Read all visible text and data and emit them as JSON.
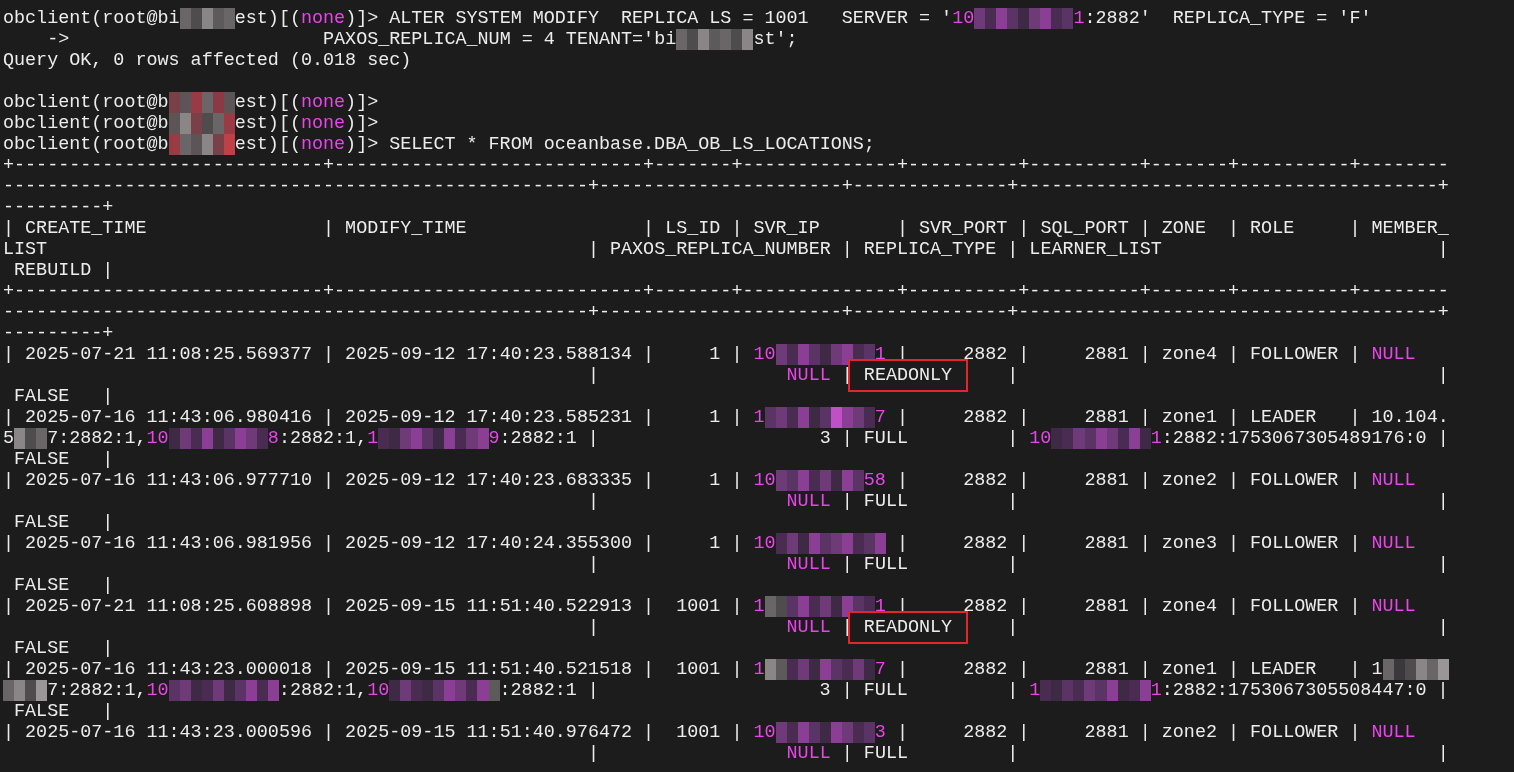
{
  "terminal": {
    "lines": [
      {
        "kind": "text",
        "segments": [
          {
            "kind": "plain",
            "text": "obclient(root@bi"
          },
          {
            "kind": "redacted",
            "tiles": [
              {
                "color": "#6a6668"
              },
              {
                "color": "#4e4c4d"
              },
              {
                "color": "#8a8688"
              },
              {
                "color": "#5c5a5b"
              },
              {
                "color": "#6a6668"
              }
            ]
          },
          {
            "kind": "plain",
            "text": "est)[("
          },
          {
            "kind": "highlight",
            "text": "none"
          },
          {
            "kind": "plain",
            "text": ")]> ALTER SYSTEM MODIFY  REPLICA LS = 1001   SERVER = '"
          },
          {
            "kind": "highlight",
            "text": "10"
          },
          {
            "kind": "redacted",
            "tiles": [
              {
                "color": "#6e3a78"
              },
              {
                "color": "#4a2c52"
              },
              {
                "color": "#8a3f94"
              },
              {
                "color": "#5b3466"
              },
              {
                "color": "#3e2a44"
              },
              {
                "color": "#6e3a78"
              },
              {
                "color": "#8a3f94"
              },
              {
                "color": "#4a2c52"
              },
              {
                "color": "#5b3466"
              }
            ]
          },
          {
            "kind": "highlight",
            "text": "1"
          },
          {
            "kind": "plain",
            "text": ":2882'  REPLICA_TYPE = 'F'"
          }
        ]
      },
      {
        "kind": "text",
        "segments": [
          {
            "kind": "plain",
            "text": "    ->                       PAXOS_REPLICA_NUM = 4 TENANT='bi"
          },
          {
            "kind": "redacted",
            "tiles": [
              {
                "color": "#6a6668"
              },
              {
                "color": "#4e4c4d"
              },
              {
                "color": "#8a8688"
              },
              {
                "color": "#5c5a5b"
              },
              {
                "color": "#6a6668"
              },
              {
                "color": "#4e4c4d"
              },
              {
                "color": "#8a8688"
              }
            ]
          },
          {
            "kind": "plain",
            "text": "st';"
          }
        ]
      },
      {
        "kind": "text",
        "segments": [
          {
            "kind": "plain",
            "text": "Query OK, 0 rows affected (0.018 sec)"
          }
        ]
      },
      {
        "kind": "blank"
      },
      {
        "kind": "text",
        "segments": [
          {
            "kind": "plain",
            "text": "obclient(root@b"
          },
          {
            "kind": "redacted",
            "tiles": [
              {
                "color": "#7a4048"
              },
              {
                "color": "#5c5456"
              },
              {
                "color": "#9a3a44"
              },
              {
                "color": "#6a6668"
              },
              {
                "color": "#8a3a44"
              },
              {
                "color": "#5c5456"
              }
            ]
          },
          {
            "kind": "plain",
            "text": "est)[("
          },
          {
            "kind": "highlight",
            "text": "none"
          },
          {
            "kind": "plain",
            "text": ")]>"
          }
        ]
      },
      {
        "kind": "text",
        "segments": [
          {
            "kind": "plain",
            "text": "obclient(root@b"
          },
          {
            "kind": "redacted",
            "tiles": [
              {
                "color": "#5c5456"
              },
              {
                "color": "#8a8688"
              },
              {
                "color": "#7a4048"
              },
              {
                "color": "#4e4c4d"
              },
              {
                "color": "#6a6668"
              },
              {
                "color": "#9a3a44"
              }
            ]
          },
          {
            "kind": "plain",
            "text": "est)[("
          },
          {
            "kind": "highlight",
            "text": "none"
          },
          {
            "kind": "plain",
            "text": ")]>"
          }
        ]
      },
      {
        "kind": "text",
        "segments": [
          {
            "kind": "plain",
            "text": "obclient(root@b"
          },
          {
            "kind": "redacted",
            "tiles": [
              {
                "color": "#9a3a44"
              },
              {
                "color": "#6a6668"
              },
              {
                "color": "#5c5456"
              },
              {
                "color": "#8a8688"
              },
              {
                "color": "#7a4048"
              },
              {
                "color": "#c04048"
              }
            ]
          },
          {
            "kind": "plain",
            "text": "est)[("
          },
          {
            "kind": "highlight",
            "text": "none"
          },
          {
            "kind": "plain",
            "text": ")]> SELECT * FROM oceanbase.DBA_OB_LS_LOCATIONS;"
          }
        ]
      },
      {
        "kind": "text",
        "segments": [
          {
            "kind": "plain",
            "text": "+----------------------------+----------------------------+-------+--------------+----------+----------+-------+----------+--------"
          }
        ]
      },
      {
        "kind": "text",
        "segments": [
          {
            "kind": "plain",
            "text": "-----------------------------------------------------+----------------------+--------------+--------------------------------------+"
          }
        ]
      },
      {
        "kind": "text",
        "segments": [
          {
            "kind": "plain",
            "text": "---------+"
          }
        ]
      },
      {
        "kind": "text",
        "segments": [
          {
            "kind": "plain",
            "text": "| CREATE_TIME                | MODIFY_TIME                | LS_ID | SVR_IP       | SVR_PORT | SQL_PORT | ZONE  | ROLE     | MEMBER_"
          }
        ]
      },
      {
        "kind": "text",
        "segments": [
          {
            "kind": "plain",
            "text": "LIST                                                 | PAXOS_REPLICA_NUMBER | REPLICA_TYPE | LEARNER_LIST                         |"
          }
        ]
      },
      {
        "kind": "text",
        "segments": [
          {
            "kind": "plain",
            "text": " REBUILD |"
          }
        ]
      },
      {
        "kind": "text",
        "segments": [
          {
            "kind": "plain",
            "text": "+----------------------------+----------------------------+-------+--------------+----------+----------+-------+----------+--------"
          }
        ]
      },
      {
        "kind": "text",
        "segments": [
          {
            "kind": "plain",
            "text": "-----------------------------------------------------+----------------------+--------------+--------------------------------------+"
          }
        ]
      },
      {
        "kind": "text",
        "segments": [
          {
            "kind": "plain",
            "text": "---------+"
          }
        ]
      },
      {
        "kind": "text",
        "segments": [
          {
            "kind": "plain",
            "text": "| 2025-07-21 11:08:25.569377 | 2025-09-12 17:40:23.588134 |     1 | "
          },
          {
            "kind": "highlight",
            "text": "10"
          },
          {
            "kind": "redacted",
            "tiles": [
              {
                "color": "#6e3a78"
              },
              {
                "color": "#4a2c52"
              },
              {
                "color": "#8a3f94"
              },
              {
                "color": "#5b3466"
              },
              {
                "color": "#3e2a44"
              },
              {
                "color": "#6e3a78"
              },
              {
                "color": "#8a3f94"
              },
              {
                "color": "#4a2c52"
              },
              {
                "color": "#5b3466"
              }
            ]
          },
          {
            "kind": "highlight",
            "text": "1"
          },
          {
            "kind": "plain",
            "text": " |     2882 |     2881 | zone4 | FOLLOWER | "
          },
          {
            "kind": "highlight",
            "text": "NULL"
          }
        ]
      },
      {
        "kind": "text",
        "segments": [
          {
            "kind": "plain",
            "text": "                                                     |                 "
          },
          {
            "kind": "highlight",
            "text": "NULL"
          },
          {
            "kind": "plain",
            "text": " | "
          },
          {
            "kind": "boxed",
            "text": "READONLY"
          },
          {
            "kind": "plain",
            "text": "     |                                      |"
          }
        ]
      },
      {
        "kind": "text",
        "segments": [
          {
            "kind": "plain",
            "text": " FALSE   |"
          }
        ]
      },
      {
        "kind": "text",
        "segments": [
          {
            "kind": "plain",
            "text": "| 2025-07-16 11:43:06.980416 | 2025-09-12 17:40:23.585231 |     1 | "
          },
          {
            "kind": "highlight",
            "text": "1"
          },
          {
            "kind": "redacted",
            "tiles": [
              {
                "color": "#5b3466"
              },
              {
                "color": "#6e3a78"
              },
              {
                "color": "#4a2c52"
              },
              {
                "color": "#8a3f94"
              },
              {
                "color": "#3e2a44"
              },
              {
                "color": "#5b3466"
              },
              {
                "color": "#c050c8"
              },
              {
                "color": "#8a3f94"
              },
              {
                "color": "#6e3a78"
              },
              {
                "color": "#4a2c52"
              }
            ]
          },
          {
            "kind": "highlight",
            "text": "7"
          },
          {
            "kind": "plain",
            "text": " |     2882 |     2881 | zone1 | LEADER   | 10.104."
          }
        ]
      },
      {
        "kind": "text",
        "segments": [
          {
            "kind": "plain",
            "text": "5"
          },
          {
            "kind": "redacted",
            "tiles": [
              {
                "color": "#8a8688"
              },
              {
                "color": "#4e4c4d"
              },
              {
                "color": "#6a6668"
              }
            ]
          },
          {
            "kind": "plain",
            "text": "7:2882:1,"
          },
          {
            "kind": "highlight",
            "text": "10"
          },
          {
            "kind": "redacted",
            "tiles": [
              {
                "color": "#3e2a44"
              },
              {
                "color": "#6e3a78"
              },
              {
                "color": "#4a2c52"
              },
              {
                "color": "#8a3f94"
              },
              {
                "color": "#3e2a44"
              },
              {
                "color": "#5b3466"
              },
              {
                "color": "#8a3f94"
              },
              {
                "color": "#6e3a78"
              },
              {
                "color": "#4a2c52"
              }
            ]
          },
          {
            "kind": "highlight",
            "text": "8"
          },
          {
            "kind": "plain",
            "text": ":2882:1,"
          },
          {
            "kind": "highlight",
            "text": "1"
          },
          {
            "kind": "redacted",
            "tiles": [
              {
                "color": "#4a2c52"
              },
              {
                "color": "#3e2a44"
              },
              {
                "color": "#6e3a78"
              },
              {
                "color": "#8a3f94"
              },
              {
                "color": "#5b3466"
              },
              {
                "color": "#3e2a44"
              },
              {
                "color": "#8a3f94"
              },
              {
                "color": "#4a2c52"
              },
              {
                "color": "#6e3a78"
              },
              {
                "color": "#8a3f94"
              }
            ]
          },
          {
            "kind": "highlight",
            "text": "9"
          },
          {
            "kind": "plain",
            "text": ":2882:1 |                    3 | FULL         | "
          },
          {
            "kind": "highlight",
            "text": "10"
          },
          {
            "kind": "redacted",
            "tiles": [
              {
                "color": "#3e2a44"
              },
              {
                "color": "#4a2c52"
              },
              {
                "color": "#6e3a78"
              },
              {
                "color": "#5b3466"
              },
              {
                "color": "#8a3f94"
              },
              {
                "color": "#6e3a78"
              },
              {
                "color": "#4a2c52"
              },
              {
                "color": "#8a3f94"
              },
              {
                "color": "#3e2a44"
              }
            ]
          },
          {
            "kind": "highlight",
            "text": "1"
          },
          {
            "kind": "plain",
            "text": ":2882:1753067305489176:0 |"
          }
        ]
      },
      {
        "kind": "text",
        "segments": [
          {
            "kind": "plain",
            "text": " FALSE   |"
          }
        ]
      },
      {
        "kind": "text",
        "segments": [
          {
            "kind": "plain",
            "text": "| 2025-07-16 11:43:06.977710 | 2025-09-12 17:40:23.683335 |     1 | "
          },
          {
            "kind": "highlight",
            "text": "10"
          },
          {
            "kind": "redacted",
            "tiles": [
              {
                "color": "#6e3a78"
              },
              {
                "color": "#5b3466"
              },
              {
                "color": "#8a3f94"
              },
              {
                "color": "#4a2c52"
              },
              {
                "color": "#6e3a78"
              },
              {
                "color": "#3e2a44"
              },
              {
                "color": "#8a3f94"
              },
              {
                "color": "#5b3466"
              }
            ]
          },
          {
            "kind": "highlight",
            "text": "58"
          },
          {
            "kind": "plain",
            "text": " |     2882 |     2881 | zone2 | FOLLOWER | "
          },
          {
            "kind": "highlight",
            "text": "NULL"
          }
        ]
      },
      {
        "kind": "text",
        "segments": [
          {
            "kind": "plain",
            "text": "                                                     |                 "
          },
          {
            "kind": "highlight",
            "text": "NULL"
          },
          {
            "kind": "plain",
            "text": " | FULL         |                                      |"
          }
        ]
      },
      {
        "kind": "text",
        "segments": [
          {
            "kind": "plain",
            "text": " FALSE   |"
          }
        ]
      },
      {
        "kind": "text",
        "segments": [
          {
            "kind": "plain",
            "text": "| 2025-07-16 11:43:06.981956 | 2025-09-12 17:40:24.355300 |     1 | "
          },
          {
            "kind": "highlight",
            "text": "10"
          },
          {
            "kind": "redacted",
            "tiles": [
              {
                "color": "#4a2c52"
              },
              {
                "color": "#6e3a78"
              },
              {
                "color": "#3e2a44"
              },
              {
                "color": "#8a3f94"
              },
              {
                "color": "#5b3466"
              },
              {
                "color": "#6e3a78"
              },
              {
                "color": "#8a3f94"
              },
              {
                "color": "#4a2c52"
              },
              {
                "color": "#5b3466"
              },
              {
                "color": "#8a3f94"
              }
            ]
          },
          {
            "kind": "plain",
            "text": " |     2882 |     2881 | zone3 | FOLLOWER | "
          },
          {
            "kind": "highlight",
            "text": "NULL"
          }
        ]
      },
      {
        "kind": "text",
        "segments": [
          {
            "kind": "plain",
            "text": "                                                     |                 "
          },
          {
            "kind": "highlight",
            "text": "NULL"
          },
          {
            "kind": "plain",
            "text": " | FULL         |                                      |"
          }
        ]
      },
      {
        "kind": "text",
        "segments": [
          {
            "kind": "plain",
            "text": " FALSE   |"
          }
        ]
      },
      {
        "kind": "text",
        "segments": [
          {
            "kind": "plain",
            "text": "| 2025-07-21 11:08:25.608898 | 2025-09-15 11:51:40.522913 |  1001 | "
          },
          {
            "kind": "highlight",
            "text": "1"
          },
          {
            "kind": "redacted",
            "tiles": [
              {
                "color": "#6a6668"
              },
              {
                "color": "#4e4c4d"
              },
              {
                "color": "#5b3466"
              },
              {
                "color": "#8a3f94"
              },
              {
                "color": "#4a2c52"
              },
              {
                "color": "#6e3a78"
              },
              {
                "color": "#3e2a44"
              },
              {
                "color": "#8a3f94"
              },
              {
                "color": "#5b3466"
              },
              {
                "color": "#4a2c52"
              }
            ]
          },
          {
            "kind": "highlight",
            "text": "1"
          },
          {
            "kind": "plain",
            "text": " |     2882 |     2881 | zone4 | FOLLOWER | "
          },
          {
            "kind": "highlight",
            "text": "NULL"
          }
        ]
      },
      {
        "kind": "text",
        "segments": [
          {
            "kind": "plain",
            "text": "                                                     |                 "
          },
          {
            "kind": "highlight",
            "text": "NULL"
          },
          {
            "kind": "plain",
            "text": " | "
          },
          {
            "kind": "boxed",
            "text": "READONLY"
          },
          {
            "kind": "plain",
            "text": "     |                                      |"
          }
        ]
      },
      {
        "kind": "text",
        "segments": [
          {
            "kind": "plain",
            "text": " FALSE   |"
          }
        ]
      },
      {
        "kind": "text",
        "segments": [
          {
            "kind": "plain",
            "text": "| 2025-07-16 11:43:23.000018 | 2025-09-15 11:51:40.521518 |  1001 | "
          },
          {
            "kind": "highlight",
            "text": "1"
          },
          {
            "kind": "redacted",
            "tiles": [
              {
                "color": "#8a8688"
              },
              {
                "color": "#5c5a5b"
              },
              {
                "color": "#4a2c52"
              },
              {
                "color": "#6e3a78"
              },
              {
                "color": "#3e2a44"
              },
              {
                "color": "#8a3f94"
              },
              {
                "color": "#5b3466"
              },
              {
                "color": "#4a2c52"
              },
              {
                "color": "#6e3a78"
              },
              {
                "color": "#3e2a44"
              }
            ]
          },
          {
            "kind": "highlight",
            "text": "7"
          },
          {
            "kind": "plain",
            "text": " |     2882 |     2881 | zone1 | LEADER   | 1"
          },
          {
            "kind": "redacted",
            "tiles": [
              {
                "color": "#6a6668"
              },
              {
                "color": "#3a383a"
              },
              {
                "color": "#4e4c4d"
              },
              {
                "color": "#8a8688"
              },
              {
                "color": "#6a6668"
              },
              {
                "color": "#9a9698"
              }
            ]
          }
        ]
      },
      {
        "kind": "text",
        "segments": [
          {
            "kind": "redacted",
            "tiles": [
              {
                "color": "#6a6668"
              },
              {
                "color": "#8a8688"
              },
              {
                "color": "#4e4c4d"
              },
              {
                "color": "#9a9698"
              }
            ]
          },
          {
            "kind": "plain",
            "text": "7:2882:1,"
          },
          {
            "kind": "highlight",
            "text": "10"
          },
          {
            "kind": "redacted",
            "tiles": [
              {
                "color": "#5b3466"
              },
              {
                "color": "#6e3a78"
              },
              {
                "color": "#3e2a44"
              },
              {
                "color": "#4a2c52"
              },
              {
                "color": "#6e3a78"
              },
              {
                "color": "#3e2a44"
              },
              {
                "color": "#5b3466"
              },
              {
                "color": "#8a3f94"
              },
              {
                "color": "#4a2c52"
              },
              {
                "color": "#8a3f94"
              }
            ]
          },
          {
            "kind": "plain",
            "text": ":2882:1,"
          },
          {
            "kind": "highlight",
            "text": "10"
          },
          {
            "kind": "redacted",
            "tiles": [
              {
                "color": "#3e2a44"
              },
              {
                "color": "#6e3a78"
              },
              {
                "color": "#4a2c52"
              },
              {
                "color": "#3e2a44"
              },
              {
                "color": "#5b3466"
              },
              {
                "color": "#8a3f94"
              },
              {
                "color": "#6e3a78"
              },
              {
                "color": "#4a2c52"
              },
              {
                "color": "#8a3f94"
              },
              {
                "color": "#5c5a5b"
              }
            ]
          },
          {
            "kind": "plain",
            "text": ":2882:1 |                    3 | FULL         | "
          },
          {
            "kind": "highlight",
            "text": "1"
          },
          {
            "kind": "redacted",
            "tiles": [
              {
                "color": "#4a2c52"
              },
              {
                "color": "#3e2a44"
              },
              {
                "color": "#5b3466"
              },
              {
                "color": "#4a2c52"
              },
              {
                "color": "#6e3a78"
              },
              {
                "color": "#5b3466"
              },
              {
                "color": "#8a3f94"
              },
              {
                "color": "#3e2a44"
              },
              {
                "color": "#4a2c52"
              },
              {
                "color": "#8a3f94"
              }
            ]
          },
          {
            "kind": "highlight",
            "text": "1"
          },
          {
            "kind": "plain",
            "text": ":2882:1753067305508447:0 |"
          }
        ]
      },
      {
        "kind": "text",
        "segments": [
          {
            "kind": "plain",
            "text": " FALSE   |"
          }
        ]
      },
      {
        "kind": "text",
        "segments": [
          {
            "kind": "plain",
            "text": "| 2025-07-16 11:43:23.000596 | 2025-09-15 11:51:40.976472 |  1001 | "
          },
          {
            "kind": "highlight",
            "text": "10"
          },
          {
            "kind": "redacted",
            "tiles": [
              {
                "color": "#6e3a78"
              },
              {
                "color": "#4a2c52"
              },
              {
                "color": "#8a3f94"
              },
              {
                "color": "#5b3466"
              },
              {
                "color": "#3e2a44"
              },
              {
                "color": "#8a3f94"
              },
              {
                "color": "#6e3a78"
              },
              {
                "color": "#4a2c52"
              },
              {
                "color": "#5b3466"
              }
            ]
          },
          {
            "kind": "highlight",
            "text": "3"
          },
          {
            "kind": "plain",
            "text": " |     2882 |     2881 | zone2 | FOLLOWER | "
          },
          {
            "kind": "highlight",
            "text": "NULL"
          }
        ]
      },
      {
        "kind": "text",
        "segments": [
          {
            "kind": "plain",
            "text": "                                                     |                 "
          },
          {
            "kind": "highlight",
            "text": "NULL"
          },
          {
            "kind": "plain",
            "text": " | FULL         |                                      |"
          }
        ]
      }
    ]
  }
}
